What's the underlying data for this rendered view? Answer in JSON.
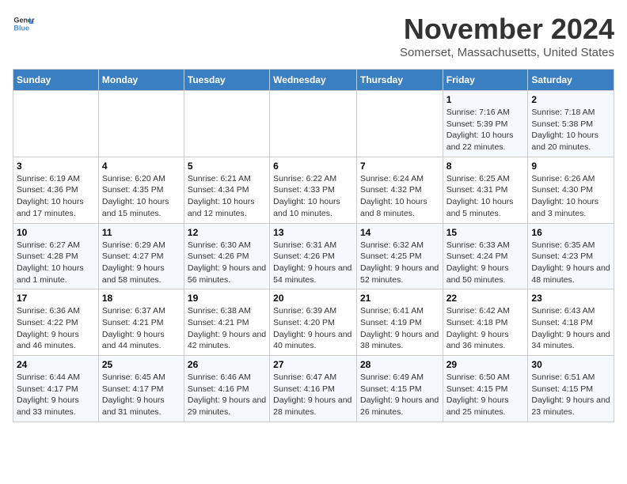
{
  "logo": {
    "line1": "General",
    "line2": "Blue"
  },
  "title": "November 2024",
  "location": "Somerset, Massachusetts, United States",
  "days_of_week": [
    "Sunday",
    "Monday",
    "Tuesday",
    "Wednesday",
    "Thursday",
    "Friday",
    "Saturday"
  ],
  "weeks": [
    [
      {
        "day": "",
        "info": ""
      },
      {
        "day": "",
        "info": ""
      },
      {
        "day": "",
        "info": ""
      },
      {
        "day": "",
        "info": ""
      },
      {
        "day": "",
        "info": ""
      },
      {
        "day": "1",
        "info": "Sunrise: 7:16 AM\nSunset: 5:39 PM\nDaylight: 10 hours and 22 minutes."
      },
      {
        "day": "2",
        "info": "Sunrise: 7:18 AM\nSunset: 5:38 PM\nDaylight: 10 hours and 20 minutes."
      }
    ],
    [
      {
        "day": "3",
        "info": "Sunrise: 6:19 AM\nSunset: 4:36 PM\nDaylight: 10 hours and 17 minutes."
      },
      {
        "day": "4",
        "info": "Sunrise: 6:20 AM\nSunset: 4:35 PM\nDaylight: 10 hours and 15 minutes."
      },
      {
        "day": "5",
        "info": "Sunrise: 6:21 AM\nSunset: 4:34 PM\nDaylight: 10 hours and 12 minutes."
      },
      {
        "day": "6",
        "info": "Sunrise: 6:22 AM\nSunset: 4:33 PM\nDaylight: 10 hours and 10 minutes."
      },
      {
        "day": "7",
        "info": "Sunrise: 6:24 AM\nSunset: 4:32 PM\nDaylight: 10 hours and 8 minutes."
      },
      {
        "day": "8",
        "info": "Sunrise: 6:25 AM\nSunset: 4:31 PM\nDaylight: 10 hours and 5 minutes."
      },
      {
        "day": "9",
        "info": "Sunrise: 6:26 AM\nSunset: 4:30 PM\nDaylight: 10 hours and 3 minutes."
      }
    ],
    [
      {
        "day": "10",
        "info": "Sunrise: 6:27 AM\nSunset: 4:28 PM\nDaylight: 10 hours and 1 minute."
      },
      {
        "day": "11",
        "info": "Sunrise: 6:29 AM\nSunset: 4:27 PM\nDaylight: 9 hours and 58 minutes."
      },
      {
        "day": "12",
        "info": "Sunrise: 6:30 AM\nSunset: 4:26 PM\nDaylight: 9 hours and 56 minutes."
      },
      {
        "day": "13",
        "info": "Sunrise: 6:31 AM\nSunset: 4:26 PM\nDaylight: 9 hours and 54 minutes."
      },
      {
        "day": "14",
        "info": "Sunrise: 6:32 AM\nSunset: 4:25 PM\nDaylight: 9 hours and 52 minutes."
      },
      {
        "day": "15",
        "info": "Sunrise: 6:33 AM\nSunset: 4:24 PM\nDaylight: 9 hours and 50 minutes."
      },
      {
        "day": "16",
        "info": "Sunrise: 6:35 AM\nSunset: 4:23 PM\nDaylight: 9 hours and 48 minutes."
      }
    ],
    [
      {
        "day": "17",
        "info": "Sunrise: 6:36 AM\nSunset: 4:22 PM\nDaylight: 9 hours and 46 minutes."
      },
      {
        "day": "18",
        "info": "Sunrise: 6:37 AM\nSunset: 4:21 PM\nDaylight: 9 hours and 44 minutes."
      },
      {
        "day": "19",
        "info": "Sunrise: 6:38 AM\nSunset: 4:21 PM\nDaylight: 9 hours and 42 minutes."
      },
      {
        "day": "20",
        "info": "Sunrise: 6:39 AM\nSunset: 4:20 PM\nDaylight: 9 hours and 40 minutes."
      },
      {
        "day": "21",
        "info": "Sunrise: 6:41 AM\nSunset: 4:19 PM\nDaylight: 9 hours and 38 minutes."
      },
      {
        "day": "22",
        "info": "Sunrise: 6:42 AM\nSunset: 4:18 PM\nDaylight: 9 hours and 36 minutes."
      },
      {
        "day": "23",
        "info": "Sunrise: 6:43 AM\nSunset: 4:18 PM\nDaylight: 9 hours and 34 minutes."
      }
    ],
    [
      {
        "day": "24",
        "info": "Sunrise: 6:44 AM\nSunset: 4:17 PM\nDaylight: 9 hours and 33 minutes."
      },
      {
        "day": "25",
        "info": "Sunrise: 6:45 AM\nSunset: 4:17 PM\nDaylight: 9 hours and 31 minutes."
      },
      {
        "day": "26",
        "info": "Sunrise: 6:46 AM\nSunset: 4:16 PM\nDaylight: 9 hours and 29 minutes."
      },
      {
        "day": "27",
        "info": "Sunrise: 6:47 AM\nSunset: 4:16 PM\nDaylight: 9 hours and 28 minutes."
      },
      {
        "day": "28",
        "info": "Sunrise: 6:49 AM\nSunset: 4:15 PM\nDaylight: 9 hours and 26 minutes."
      },
      {
        "day": "29",
        "info": "Sunrise: 6:50 AM\nSunset: 4:15 PM\nDaylight: 9 hours and 25 minutes."
      },
      {
        "day": "30",
        "info": "Sunrise: 6:51 AM\nSunset: 4:15 PM\nDaylight: 9 hours and 23 minutes."
      }
    ]
  ]
}
